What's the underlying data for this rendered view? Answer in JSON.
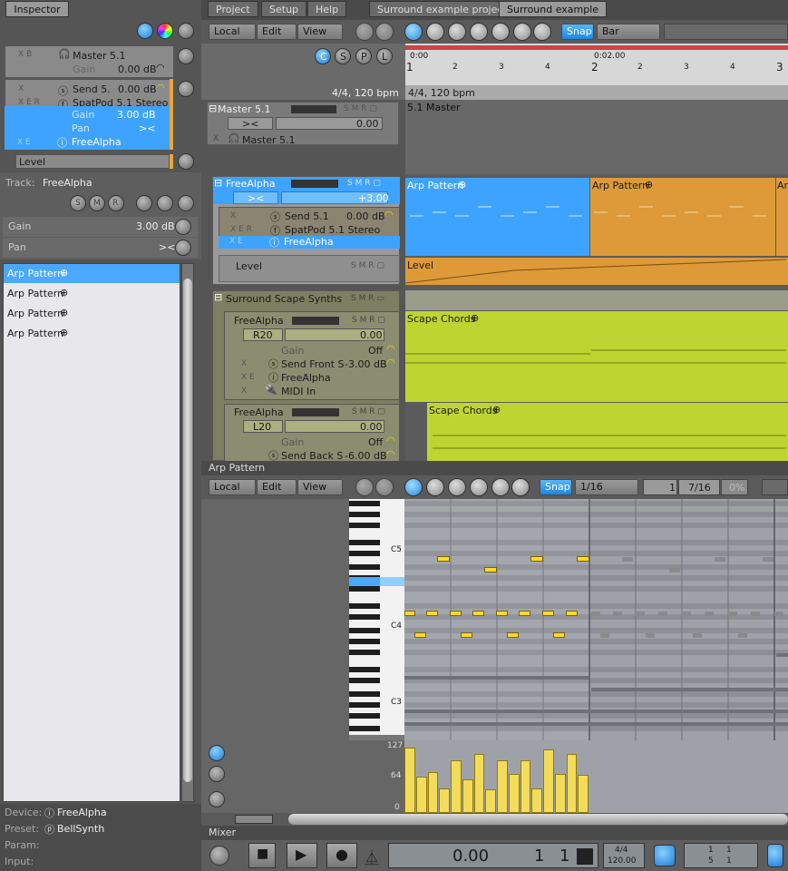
{
  "inspector": {
    "tab": "Inspector",
    "master_track": {
      "name": "Master 5.1",
      "gain_label": "Gain",
      "gain_value": "0.00 dB"
    },
    "selected_chain": {
      "send_name": "Send 5.",
      "send_value": "0.00 dB",
      "spatpod": "SpatPod 5.1 Stereo",
      "gain_label": "Gain",
      "gain_value": "3.00 dB",
      "pan_label": "Pan",
      "pan_value": "><",
      "instrument": "FreeAlpha"
    },
    "level_label": "Level",
    "track_label": "Track:",
    "track_value": "FreeAlpha",
    "smr": [
      "S",
      "M",
      "R"
    ],
    "gain_label": "Gain",
    "gain_value": "3.00 dB",
    "pan_label": "Pan",
    "pan_value": "><",
    "patterns": [
      "Arp Pattern",
      "Arp Pattern",
      "Arp Pattern",
      "Arp Pattern"
    ],
    "device_label": "Device:",
    "device_value": "FreeAlpha",
    "preset_label": "Preset:",
    "preset_value": "BellSynth",
    "param_label": "Param:",
    "input_label": "Input:"
  },
  "menu": {
    "items": [
      "Project",
      "Setup",
      "Help"
    ],
    "doc_tabs": [
      "Surround example project",
      "Surround example"
    ]
  },
  "arrange_toolbar": {
    "local": "Local",
    "edit": "Edit",
    "view": "View",
    "snap": "Snap",
    "snap_value": "Bar"
  },
  "transport_small": [
    "C",
    "S",
    "P",
    "L"
  ],
  "timeline": {
    "marks": [
      "1",
      "2",
      "3",
      "4",
      "2",
      "2",
      "3",
      "4",
      "3"
    ],
    "time_label": "0:00",
    "time_label2": "0:02.00",
    "meter": "4/4, 120 bpm",
    "meter2": "4/4, 120 bpm"
  },
  "tracks": {
    "master": {
      "name": "Master 5.1",
      "fader_value": "0.00",
      "pan": "><",
      "plugin": "Master 5.1",
      "lane_label": "5.1 Master"
    },
    "freealpha": {
      "name": "FreeAlpha",
      "pan": "><",
      "fader_value": "+3.00",
      "send": "Send 5.1",
      "send_value": "0.00 dB",
      "spatpod": "SpatPod 5.1 Stereo",
      "instrument": "FreeAlpha",
      "level": "Level",
      "clips": [
        "Arp Pattern",
        "Arp Pattern",
        "Ar"
      ],
      "level_clip": "Level"
    },
    "surround_group": {
      "name": "Surround Scape Synths"
    },
    "sub1": {
      "name": "FreeAlpha",
      "pan": "R20",
      "fader_value": "0.00",
      "gain_label": "Gain",
      "gain_value": "Off",
      "send": "Send Front S",
      "send_value": "-3.00 dB",
      "instrument": "FreeAlpha",
      "midi": "MIDI In",
      "clip": "Scape Chords"
    },
    "sub2": {
      "name": "FreeAlpha",
      "pan": "L20",
      "fader_value": "0.00",
      "gain_label": "Gain",
      "gain_value": "Off",
      "send": "Send Back S",
      "send_value": "-6.00 dB",
      "clip": "Scape Chords"
    }
  },
  "editor": {
    "title": "Arp Pattern",
    "local": "Local",
    "edit": "Edit",
    "view": "View",
    "snap": "Snap",
    "snap_value": "1/16",
    "pos_a": "1",
    "pos_b": "7/16",
    "pct": "0%",
    "octaves": [
      "C5",
      "C4",
      "C3"
    ],
    "velocity_scale": [
      "127",
      "64",
      "0"
    ],
    "velocities": [
      1.0,
      0.55,
      0.63,
      0.37,
      0.8,
      0.52,
      0.9,
      0.36,
      0.8,
      0.6,
      0.8,
      0.37,
      0.97,
      0.6,
      0.9,
      0.58
    ]
  },
  "bottom": {
    "mixer_label": "Mixer",
    "time": "0.00",
    "bar": "1",
    "beat": "1",
    "meter": "4/4",
    "tempo": "120.00",
    "loop_a": "1",
    "loop_b": "1",
    "loop_c": "5",
    "loop_d": "1"
  }
}
